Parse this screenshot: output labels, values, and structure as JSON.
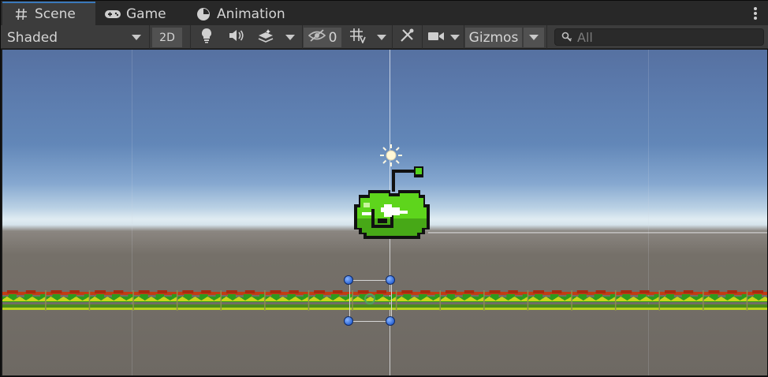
{
  "tabs": [
    {
      "label": "Scene",
      "icon": "hash-icon",
      "active": true
    },
    {
      "label": "Game",
      "icon": "gamepad-icon",
      "active": false
    },
    {
      "label": "Animation",
      "icon": "clock-icon",
      "active": false
    }
  ],
  "toolbar": {
    "draw_mode": "Shaded",
    "mode_2d": "2D",
    "hidden_count": "0",
    "gizmos": "Gizmos",
    "search_placeholder": "All"
  },
  "colors": {
    "accent": "#3a79bb",
    "toolbar_bg": "#3c3c3c",
    "tab_bg": "#282828",
    "handle": "#2e67d6",
    "apple_green": "#5ed51c"
  },
  "scene": {
    "objects": [
      "sun-light",
      "green-apple-sprite",
      "ground-tile-strip",
      "selection-rect"
    ]
  }
}
